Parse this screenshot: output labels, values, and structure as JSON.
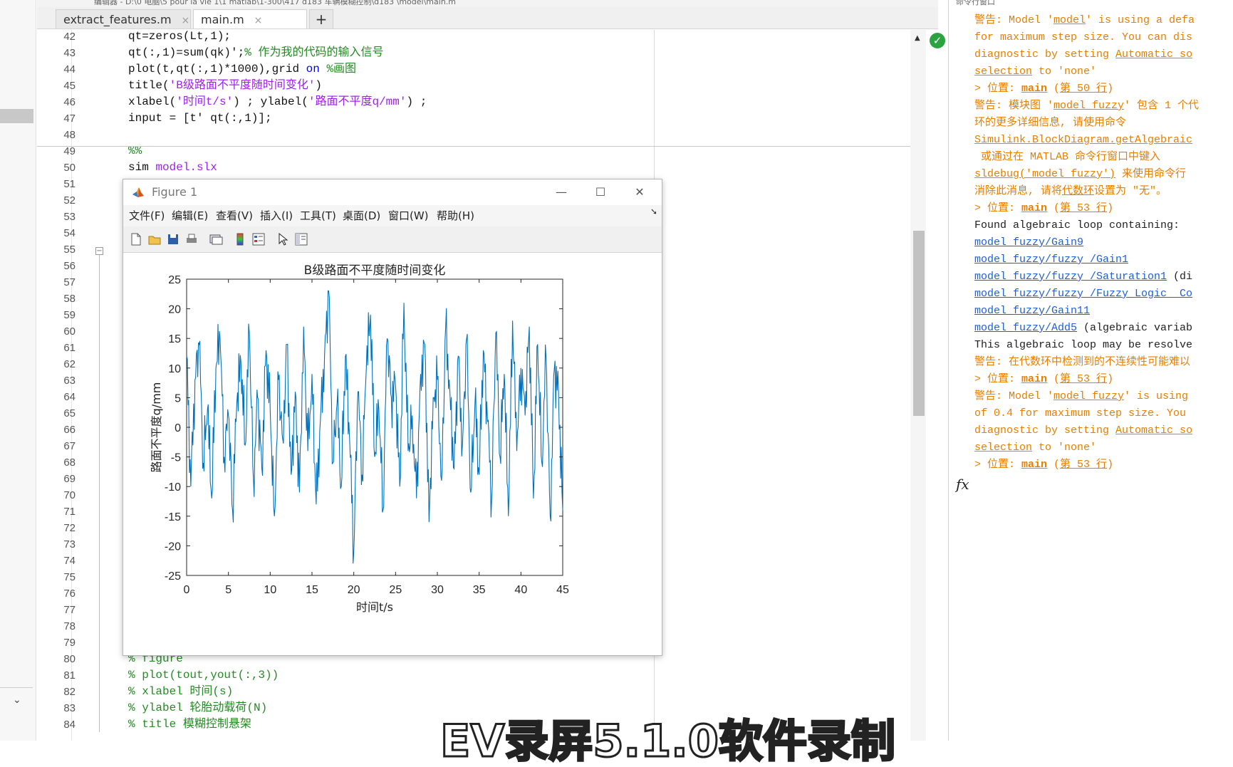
{
  "editor": {
    "title_path": "编辑器 - D:\\0 电脑\\5 pour la vie 1\\1 matlab\\1-300\\417 d183 车辆模糊控制\\d183 \\model\\main.m",
    "tabs": [
      {
        "label": "extract_features.m",
        "close": "×"
      },
      {
        "label": "main.m",
        "close": "×"
      },
      {
        "label": "+"
      }
    ],
    "lines": [
      {
        "num": "42",
        "code": [
          {
            "t": "qt=zeros(Lt,1);",
            "c": ""
          }
        ]
      },
      {
        "num": "43",
        "code": [
          {
            "t": "qt(:,1)=sum(qk)';",
            "c": ""
          },
          {
            "t": "% 作为我的代码的输入信号",
            "c": "cmt"
          }
        ]
      },
      {
        "num": "44",
        "code": [
          {
            "t": "plot(t,qt(:,1)*1000),grid ",
            "c": ""
          },
          {
            "t": "on",
            "c": "kw"
          },
          {
            "t": " ",
            "c": ""
          },
          {
            "t": "%画图",
            "c": "cmt"
          }
        ]
      },
      {
        "num": "45",
        "code": [
          {
            "t": "title(",
            "c": ""
          },
          {
            "t": "'B级路面不平度随时间变化'",
            "c": "str"
          },
          {
            "t": ")",
            "c": ""
          }
        ]
      },
      {
        "num": "46",
        "code": [
          {
            "t": "xlabel(",
            "c": ""
          },
          {
            "t": "'时间t/s'",
            "c": "str"
          },
          {
            "t": ") ; ylabel(",
            "c": ""
          },
          {
            "t": "'路面不平度q/mm'",
            "c": "str"
          },
          {
            "t": ") ;",
            "c": ""
          }
        ]
      },
      {
        "num": "47",
        "code": [
          {
            "t": "input = [t' qt(:,1)];",
            "c": ""
          }
        ]
      },
      {
        "num": "48",
        "code": []
      },
      {
        "num": "49",
        "code": [
          {
            "t": "%%",
            "c": "cmt"
          }
        ]
      },
      {
        "num": "50",
        "code": [
          {
            "t": "sim ",
            "c": ""
          },
          {
            "t": "model.slx",
            "c": "str"
          }
        ]
      },
      {
        "num": "51",
        "code": []
      },
      {
        "num": "52",
        "code": []
      },
      {
        "num": "53",
        "code": []
      },
      {
        "num": "54",
        "code": []
      },
      {
        "num": "55",
        "code": []
      },
      {
        "num": "56",
        "code": []
      },
      {
        "num": "57",
        "code": []
      },
      {
        "num": "58",
        "code": []
      },
      {
        "num": "59",
        "code": []
      },
      {
        "num": "60",
        "code": []
      },
      {
        "num": "61",
        "code": []
      },
      {
        "num": "62",
        "code": []
      },
      {
        "num": "63",
        "code": []
      },
      {
        "num": "64",
        "code": []
      },
      {
        "num": "65",
        "code": []
      },
      {
        "num": "66",
        "code": []
      },
      {
        "num": "67",
        "code": []
      },
      {
        "num": "68",
        "code": []
      },
      {
        "num": "69",
        "code": []
      },
      {
        "num": "70",
        "code": []
      },
      {
        "num": "71",
        "code": []
      },
      {
        "num": "72",
        "code": []
      },
      {
        "num": "73",
        "code": []
      },
      {
        "num": "74",
        "code": []
      },
      {
        "num": "75",
        "code": []
      },
      {
        "num": "76",
        "code": []
      },
      {
        "num": "77",
        "code": []
      },
      {
        "num": "78",
        "code": []
      },
      {
        "num": "79",
        "code": []
      },
      {
        "num": "80",
        "code": [
          {
            "t": "% figure",
            "c": "cmt"
          }
        ]
      },
      {
        "num": "81",
        "code": [
          {
            "t": "% plot(tout,yout(:,3))",
            "c": "cmt"
          }
        ]
      },
      {
        "num": "82",
        "code": [
          {
            "t": "% xlabel 时间(s)",
            "c": "cmt"
          }
        ]
      },
      {
        "num": "83",
        "code": [
          {
            "t": "% ylabel 轮胎动载荷(N)",
            "c": "cmt"
          }
        ]
      },
      {
        "num": "84",
        "code": [
          {
            "t": "% title 模糊控制悬架",
            "c": "cmt"
          }
        ]
      }
    ]
  },
  "command_window": {
    "title": "命令行窗口",
    "lines": [
      [
        {
          "t": "警告: Model '",
          "c": "warn"
        },
        {
          "t": "model",
          "c": "wl"
        },
        {
          "t": "' is using a defa",
          "c": "warn"
        }
      ],
      [
        {
          "t": "for maximum step size. You can dis",
          "c": "warn"
        }
      ],
      [
        {
          "t": "diagnostic by setting ",
          "c": "warn"
        },
        {
          "t": "Automatic so",
          "c": "wl"
        }
      ],
      [
        {
          "t": "selection",
          "c": "wl"
        },
        {
          "t": " to 'none'",
          "c": "warn"
        }
      ],
      [
        {
          "t": "> 位置: ",
          "c": "warn"
        },
        {
          "t": "main",
          "c": "wl bold"
        },
        {
          "t": " (",
          "c": "warn"
        },
        {
          "t": "第 50 行",
          "c": "wl"
        },
        {
          "t": ")",
          "c": "warn"
        }
      ],
      [
        {
          "t": "警告: 模块图 '",
          "c": "warn"
        },
        {
          "t": "model_fuzzy",
          "c": "wl"
        },
        {
          "t": "' 包含 1 个代",
          "c": "warn"
        }
      ],
      [
        {
          "t": "环的更多详细信息, 请使用命令",
          "c": "warn"
        }
      ],
      [
        {
          "t": "Simulink.BlockDiagram.getAlgebraic",
          "c": "wl"
        }
      ],
      [
        {
          "t": " 或通过在 MATLAB 命令行窗口中键入",
          "c": "warn"
        }
      ],
      [
        {
          "t": "sldebug('model_fuzzy')",
          "c": "wl"
        },
        {
          "t": " 来使用命令行",
          "c": "warn"
        }
      ],
      [
        {
          "t": "消除此消息, 请将",
          "c": "warn"
        },
        {
          "t": "代数环",
          "c": "wl"
        },
        {
          "t": "设置为 \"无\"。",
          "c": "warn"
        }
      ],
      [
        {
          "t": "> 位置: ",
          "c": "warn"
        },
        {
          "t": "main",
          "c": "wl bold"
        },
        {
          "t": " (",
          "c": "warn"
        },
        {
          "t": "第 53 行",
          "c": "wl"
        },
        {
          "t": ")",
          "c": "warn"
        }
      ],
      [
        {
          "t": "Found algebraic loop containing:",
          "c": "blk"
        }
      ],
      [
        {
          "t": "model_fuzzy/Gain9",
          "c": "lnk"
        }
      ],
      [
        {
          "t": "model_fuzzy/fuzzy /Gain1",
          "c": "lnk"
        }
      ],
      [
        {
          "t": "model_fuzzy/fuzzy /Saturation1",
          "c": "lnk"
        },
        {
          "t": " (di",
          "c": "blk"
        }
      ],
      [
        {
          "t": "model_fuzzy/fuzzy /Fuzzy Logic  Co",
          "c": "lnk"
        }
      ],
      [
        {
          "t": "model_fuzzy/Gain11",
          "c": "lnk"
        }
      ],
      [
        {
          "t": "model_fuzzy/Add5",
          "c": "lnk"
        },
        {
          "t": " (algebraic variab",
          "c": "blk"
        }
      ],
      [
        {
          "t": "This algebraic loop may be resolve",
          "c": "blk"
        }
      ],
      [
        {
          "t": "警告: 在代数环中检测到的不连续性可能难以",
          "c": "warn"
        }
      ],
      [
        {
          "t": "> 位置: ",
          "c": "warn"
        },
        {
          "t": "main",
          "c": "wl bold"
        },
        {
          "t": " (",
          "c": "warn"
        },
        {
          "t": "第 53 行",
          "c": "wl"
        },
        {
          "t": ")",
          "c": "warn"
        }
      ],
      [
        {
          "t": "警告: Model '",
          "c": "warn"
        },
        {
          "t": "model_fuzzy",
          "c": "wl"
        },
        {
          "t": "' is using",
          "c": "warn"
        }
      ],
      [
        {
          "t": "of 0.4 for maximum step size. You",
          "c": "warn"
        }
      ],
      [
        {
          "t": "diagnostic by setting ",
          "c": "warn"
        },
        {
          "t": "Automatic so",
          "c": "wl"
        }
      ],
      [
        {
          "t": "selection",
          "c": "wl"
        },
        {
          "t": " to 'none'",
          "c": "warn"
        }
      ],
      [
        {
          "t": "> 位置: ",
          "c": "warn"
        },
        {
          "t": "main",
          "c": "wl bold"
        },
        {
          "t": " (",
          "c": "warn"
        },
        {
          "t": "第 53 行",
          "c": "wl"
        },
        {
          "t": ")",
          "c": "warn"
        }
      ]
    ],
    "prompt": "fx"
  },
  "figure": {
    "title": "Figure 1",
    "controls": {
      "minimize": "—",
      "maximize": "☐",
      "close": "✕"
    },
    "menu": [
      "文件(F)",
      "编辑(E)",
      "查看(V)",
      "插入(I)",
      "工具(T)",
      "桌面(D)",
      "窗口(W)",
      "帮助(H)"
    ],
    "toolbar_icons": [
      "new-file-icon",
      "open-folder-icon",
      "save-icon",
      "print-icon",
      "link-plot-icon",
      "colorbar-icon",
      "legend-icon",
      "pointer-icon",
      "property-editor-icon"
    ]
  },
  "chart_data": {
    "type": "line",
    "title": "B级路面不平度随时间变化",
    "xlabel": "时间t/s",
    "ylabel": "路面不平度q/mm",
    "xlim": [
      0,
      45
    ],
    "ylim": [
      -25,
      25
    ],
    "xticks": [
      "0",
      "5",
      "10",
      "15",
      "20",
      "25",
      "30",
      "35",
      "40",
      "45"
    ],
    "yticks": [
      "25",
      "20",
      "15",
      "10",
      "5",
      "0",
      "-5",
      "-10",
      "-15",
      "-20",
      "-25"
    ],
    "grid": false,
    "line_color": "#0072bd",
    "series": [
      {
        "x": [
          0,
          0.5,
          1,
          1.5,
          2,
          2.5,
          3,
          3.5,
          4,
          4.5,
          5,
          5.5,
          6,
          6.5,
          7,
          7.5,
          8,
          8.5,
          9,
          9.5,
          10,
          10.5,
          11,
          11.5,
          12,
          12.5,
          13,
          13.5,
          14,
          14.5,
          15,
          15.5,
          16,
          16.5,
          17,
          17.5,
          18,
          18.5,
          19,
          19.5,
          20,
          20.5,
          21,
          21.5,
          22,
          22.5,
          23,
          23.5,
          24,
          24.5,
          25,
          25.5,
          26,
          26.5,
          27,
          27.5,
          28,
          28.5,
          29,
          29.5,
          30,
          30.5,
          31,
          31.5,
          32,
          32.5,
          33,
          33.5,
          34,
          34.5,
          35,
          35.5,
          36,
          36.5,
          37,
          37.5,
          38,
          38.5,
          39,
          39.5,
          40,
          40.5,
          41,
          41.5,
          42,
          42.5,
          43,
          43.5,
          44,
          44.5,
          45
        ],
        "y": [
          12,
          -10,
          8,
          14,
          -6,
          3,
          -12,
          10,
          15,
          -5,
          2,
          -14,
          4,
          11,
          -3,
          16,
          -9,
          5,
          -7,
          13,
          3,
          -15,
          8,
          -2,
          14,
          -8,
          6,
          -11,
          17,
          -4,
          9,
          -13,
          1,
          12,
          23,
          -6,
          4,
          -10,
          12,
          -2,
          -21,
          6,
          -8,
          10,
          19,
          -5,
          3,
          -14,
          15,
          5,
          7,
          -10,
          21,
          -4,
          2,
          -12,
          9,
          14,
          -16,
          5,
          8,
          -9,
          17,
          6,
          -7,
          12,
          -3,
          15,
          -11,
          4,
          -8,
          13,
          1,
          -12,
          16,
          -5,
          9,
          -15,
          18,
          -4,
          10,
          2,
          17,
          -12,
          14,
          -6,
          12,
          -15,
          10,
          6,
          -14
        ]
      }
    ]
  },
  "overlay_caption": "EV录屏5.1.0软件录制"
}
